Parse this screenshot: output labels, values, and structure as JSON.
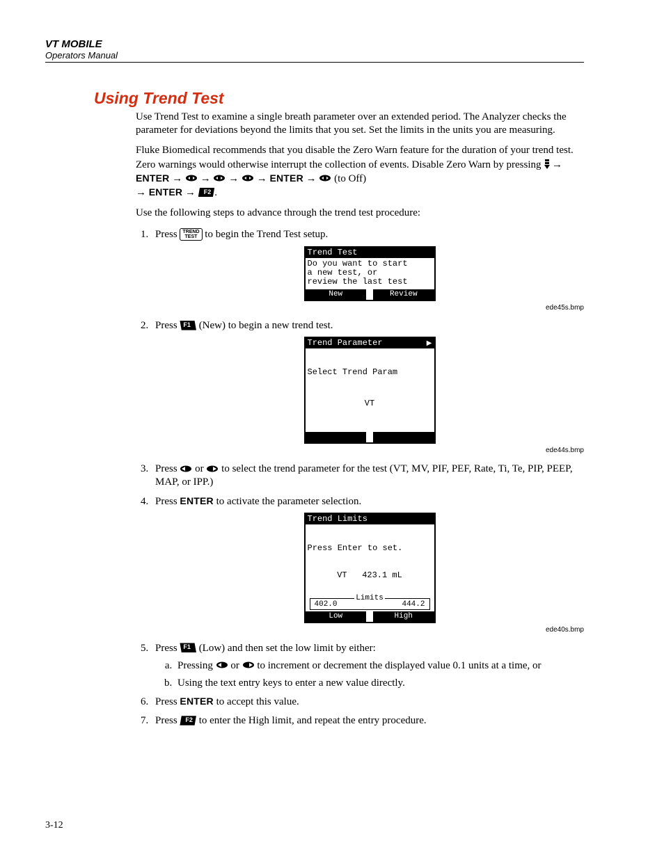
{
  "header": {
    "product": "VT MOBILE",
    "subtitle": "Operators Manual"
  },
  "section_title": "Using Trend Test",
  "intro_p1": "Use Trend Test to examine a single breath parameter over an extended period. The Analyzer checks the parameter for deviations beyond the limits that you set. Set the limits in the units you are measuring.",
  "intro_p2_a": "Fluke Biomedical recommends that you disable the Zero Warn feature for the duration of your trend test. Zero warnings would otherwise interrupt the collection of events. Disable Zero Warn by pressing ",
  "intro_p2_off": " (to Off) ",
  "intro_p2_end": ".",
  "enter_label": "ENTER",
  "arrow": "→",
  "intro_p3": "Use the following steps to advance through the trend test procedure:",
  "steps": {
    "s1_a": "Press ",
    "s1_key": "TREND\nTEST",
    "s1_b": " to begin the Trend Test setup.",
    "s2_a": "Press ",
    "s2_key": "F1",
    "s2_b": " (New) to begin a new trend test.",
    "s3_a": "Press ",
    "s3_b": " or ",
    "s3_c": " to select the trend parameter for the test (VT, MV, PIF, PEF, Rate, Ti, Te, PIP, PEEP, MAP, or IPP.)",
    "s4_a": "Press ",
    "s4_b": " to activate the parameter selection.",
    "s5_a": "Press ",
    "s5_key": "F1",
    "s5_b": " (Low) and then set the low limit by either:",
    "s5_sub_a_1": "Pressing ",
    "s5_sub_a_2": " or ",
    "s5_sub_a_3": " to increment or decrement the displayed value 0.1 units at a time, or",
    "s5_sub_b": "Using the text entry keys to enter a new value directly.",
    "s6_a": "Press ",
    "s6_b": " to accept this value.",
    "s7_a": "Press ",
    "s7_key": "F2",
    "s7_b": " to enter the High limit, and repeat the entry procedure."
  },
  "captions": {
    "c1": "ede45s.bmp",
    "c2": "ede44s.bmp",
    "c3": "ede40s.bmp"
  },
  "lcd1": {
    "title": "Trend Test",
    "body": "Do you want to start\na new test, or\nreview the last test",
    "btn_l": "New",
    "btn_r": "Review"
  },
  "lcd2": {
    "title": "Trend Parameter",
    "body": "Select Trend Param",
    "value": "VT"
  },
  "lcd3": {
    "title": "Trend Limits",
    "line1": "Press Enter to set.",
    "line2": "VT   423.1 mL",
    "limits_label": "Limits",
    "low": "402.0",
    "high": "444.2",
    "btn_l": "Low",
    "btn_r": "High"
  },
  "page_number": "3-12"
}
